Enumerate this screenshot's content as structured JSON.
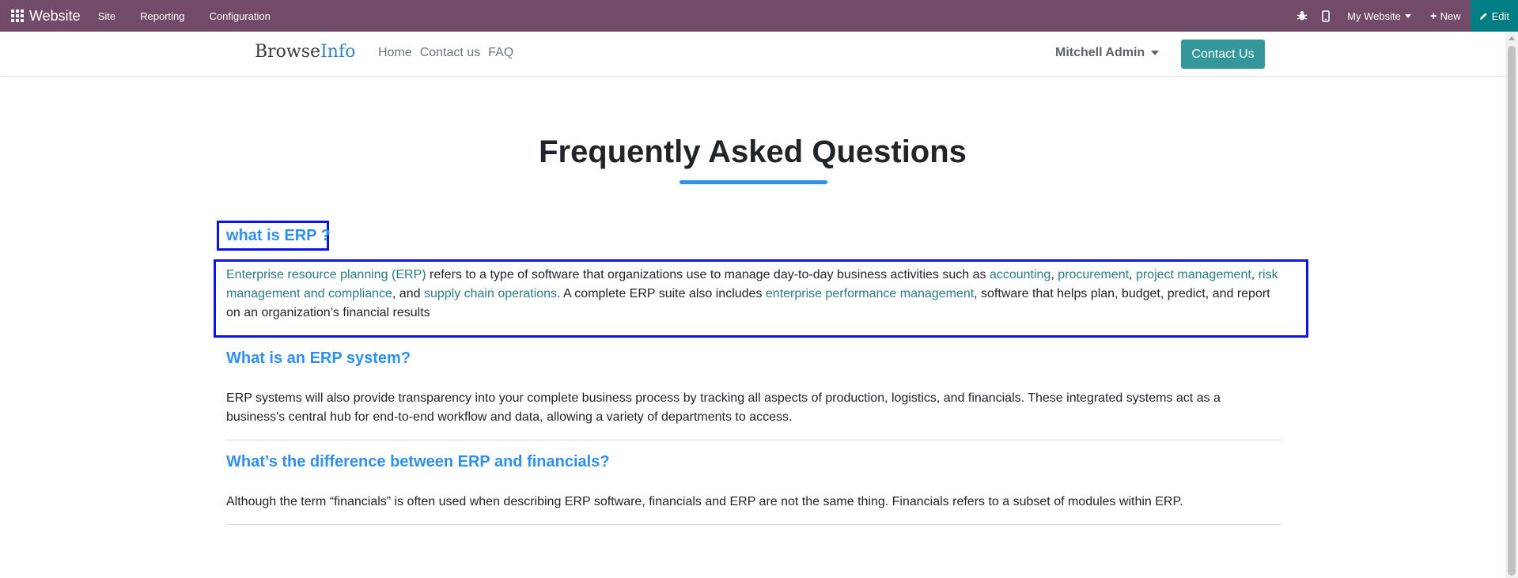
{
  "topbar": {
    "brand": "Website",
    "menu": [
      "Site",
      "Reporting",
      "Configuration"
    ],
    "website_selector": "My Website",
    "new_label": "New",
    "edit_label": "Edit",
    "bg_color": "#714b67",
    "edit_bg_color": "#017e84"
  },
  "sitenav": {
    "logo_part1": "Browse",
    "logo_part2": "Info",
    "links": [
      "Home",
      "Contact us",
      "FAQ"
    ],
    "user": "Mitchell Admin",
    "contact_button": "Contact Us",
    "accent_color": "#35979c"
  },
  "page": {
    "title": "Frequently Asked Questions",
    "faqs": [
      {
        "question": "what is ERP ?",
        "answer_parts": [
          {
            "text": "Enterprise resource planning (ERP)",
            "link": true
          },
          {
            "text": " refers to a type of software that organizations use to manage day-to-day business activities such as ",
            "link": false
          },
          {
            "text": "accounting",
            "link": true
          },
          {
            "text": ", ",
            "link": false
          },
          {
            "text": "procurement",
            "link": true
          },
          {
            "text": ", ",
            "link": false
          },
          {
            "text": "project management",
            "link": true
          },
          {
            "text": ", ",
            "link": false
          },
          {
            "text": "risk management and compliance",
            "link": true
          },
          {
            "text": ", and ",
            "link": false
          },
          {
            "text": "supply chain operations",
            "link": true
          },
          {
            "text": ". A complete ERP suite also includes ",
            "link": false
          },
          {
            "text": "enterprise performance management",
            "link": true
          },
          {
            "text": ", software that helps plan, budget, predict, and report on an organization’s financial results",
            "link": false
          }
        ]
      },
      {
        "question": "What is an ERP system?",
        "answer": "ERP systems will also provide transparency into your complete business process by tracking all aspects of production, logistics, and financials. These integrated systems act as a business's central hub for end-to-end workflow and data, allowing a variety of departments to access."
      },
      {
        "question": "What’s the difference between ERP and financials?",
        "answer": "Although the term “financials” is often used when describing ERP software, financials and ERP are not the same thing. Financials refers to a subset of modules within ERP."
      }
    ],
    "heading_color": "#2d8ff0",
    "link_color": "#2c7c82",
    "highlight_color": "#0a14e8"
  }
}
